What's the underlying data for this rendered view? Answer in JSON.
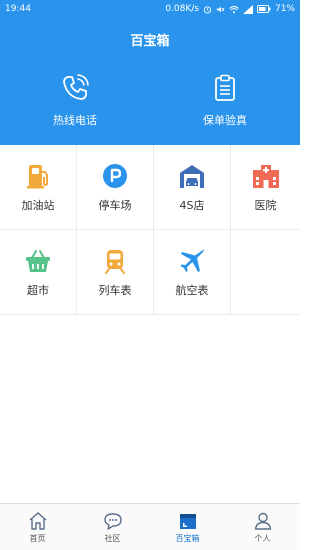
{
  "status_bar": {
    "time": "19:44",
    "speed": "0.08K/s",
    "battery": "71%"
  },
  "header": {
    "title": "百宝箱"
  },
  "hero": {
    "items": [
      {
        "label": "热线电话",
        "icon": "phone-icon"
      },
      {
        "label": "保单验真",
        "icon": "clipboard-icon"
      }
    ]
  },
  "grid": {
    "items": [
      {
        "label": "加油站",
        "icon": "gas-station-icon",
        "color": "#f2a93b"
      },
      {
        "label": "停车场",
        "icon": "parking-icon",
        "color": "#2a94ec"
      },
      {
        "label": "4S店",
        "icon": "garage-icon",
        "color": "#3e6db8"
      },
      {
        "label": "医院",
        "icon": "hospital-icon",
        "color": "#f06a55"
      },
      {
        "label": "超市",
        "icon": "basket-icon",
        "color": "#56c38a"
      },
      {
        "label": "列车表",
        "icon": "train-icon",
        "color": "#f2a93b"
      },
      {
        "label": "航空表",
        "icon": "airplane-icon",
        "color": "#2a94ec"
      }
    ]
  },
  "tab_bar": {
    "tabs": [
      {
        "label": "首页",
        "icon": "home-icon"
      },
      {
        "label": "社区",
        "icon": "chat-icon"
      },
      {
        "label": "百宝箱",
        "icon": "toolbox-icon",
        "active": true
      },
      {
        "label": "个人",
        "icon": "person-icon"
      }
    ]
  },
  "colors": {
    "primary": "#2a94ec",
    "active_tab": "#1b6fc9"
  }
}
